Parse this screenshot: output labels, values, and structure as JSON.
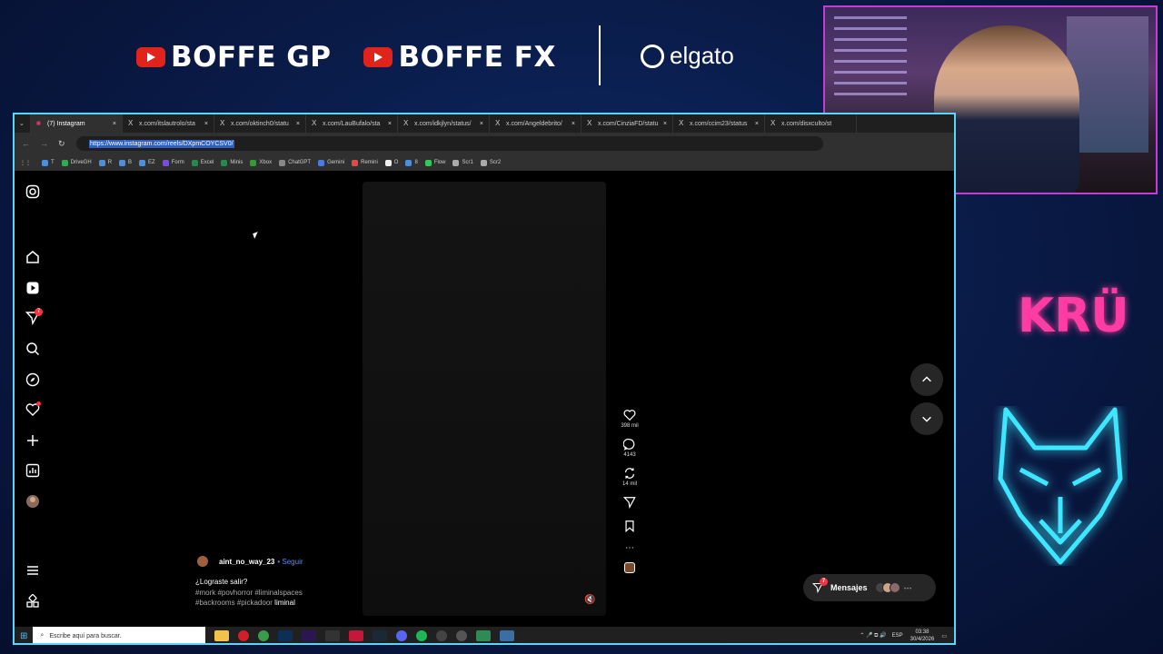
{
  "overlay": {
    "channel1": "BOFFE GP",
    "channel2": "BOFFE FX",
    "sponsor": "elgato",
    "brand_right": "KRÜ"
  },
  "browser": {
    "tabs": [
      {
        "label": "(7) Instagram",
        "active": true
      },
      {
        "label": "x.com/itslautrolo/sta"
      },
      {
        "label": "x.com/oktinch0/statu"
      },
      {
        "label": "x.com/LauBufalo/sta"
      },
      {
        "label": "x.com/idkjlyn/status/"
      },
      {
        "label": "x.com/Angeldebrito/"
      },
      {
        "label": "x.com/CinziaFD/statu"
      },
      {
        "label": "x.com/ccim23/status"
      },
      {
        "label": "x.com/disxculto/st"
      }
    ],
    "url": "https://www.instagram.com/reels/DXpmCOYCSV0/",
    "bookmarks": [
      "T",
      "DriveGH",
      "R",
      "B",
      "EZ",
      "Form",
      "Excel",
      "Minis",
      "Xbox",
      "ChatGPT",
      "Gemini",
      "Remini",
      "O",
      "8",
      "Flow",
      "Scr1",
      "Scr2"
    ]
  },
  "reel": {
    "likes": "398 mil",
    "comments": "4143",
    "reposts": "14 mil",
    "username": "aint_no_way_23",
    "follow": "• Seguir",
    "caption": "¿Lograste salir?",
    "tags_line1": "#mork #povhorror #liminalspaces",
    "tags_line2": "#backrooms #pickadoor",
    "tags_line2_highlight": "liminal"
  },
  "notifications": {
    "sidebar_badge": "7",
    "messages_badge": "7"
  },
  "messages": {
    "label": "Mensajes"
  },
  "taskbar": {
    "search_placeholder": "Escribe aquí para buscar.",
    "language": "ESP",
    "time": "03:38",
    "date": "30/4/2026"
  }
}
